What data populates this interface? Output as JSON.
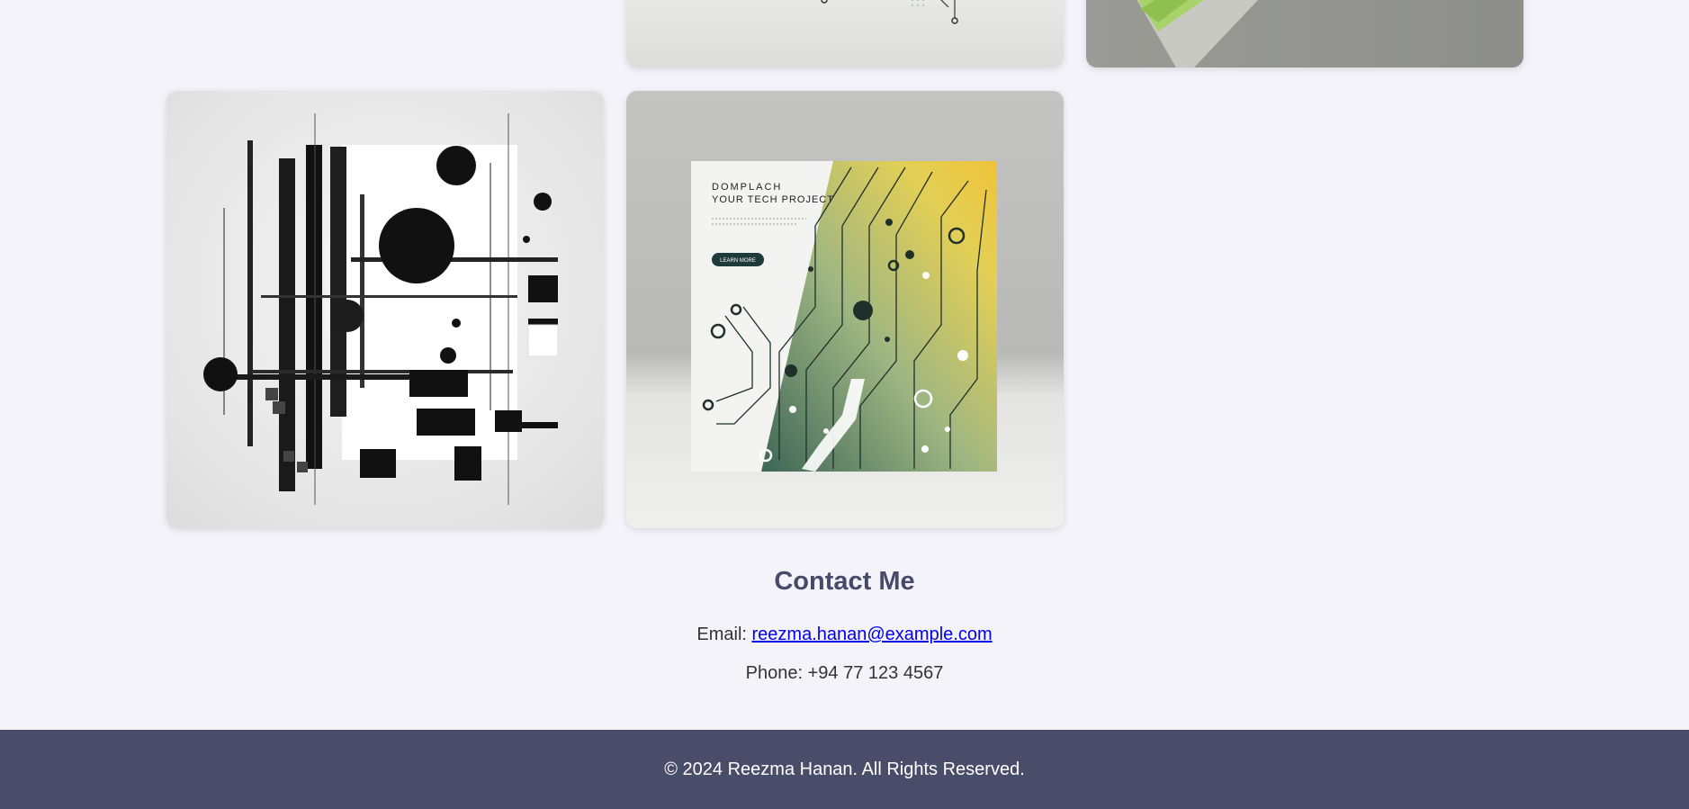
{
  "gallery": {
    "items": [
      {
        "alt": "Abstract circuit artwork (partial)"
      },
      {
        "alt": "Green book cover mockup (partial)"
      },
      {
        "alt": "Black and white geometric abstract art"
      },
      {
        "alt": "Tech project poster with circuit pattern"
      }
    ],
    "poster": {
      "headline": "DOMPLACH",
      "subheadline": "YOUR TECH PROJECT",
      "button_label": "LEARN MORE"
    }
  },
  "contact": {
    "title": "Contact Me",
    "email_label": "Email:",
    "email": "reezma.hanan@example.com",
    "phone_label": "Phone:",
    "phone": "+94 77 123 4567"
  },
  "footer": {
    "copyright": "© 2024 Reezma Hanan. All Rights Reserved."
  },
  "colors": {
    "background": "#f4f3f9",
    "heading": "#474b69",
    "footer_bg": "#4a4d69",
    "link": "#0000ee"
  }
}
